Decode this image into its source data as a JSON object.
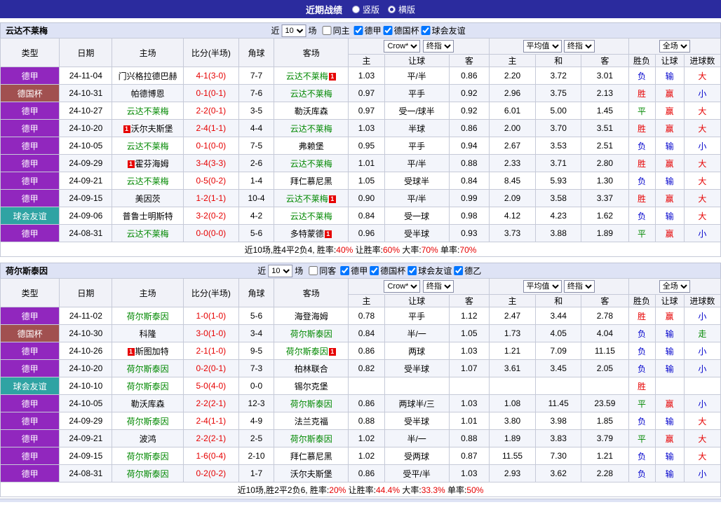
{
  "topbar": {
    "title": "近期战绩",
    "options": [
      {
        "label": "竖版",
        "selected": false
      },
      {
        "label": "横版",
        "selected": true
      }
    ]
  },
  "columns": {
    "type": "类型",
    "date": "日期",
    "home": "主场",
    "score": "比分(半场)",
    "corners": "角球",
    "away": "客场",
    "sub": [
      "主",
      "让球",
      "客",
      "主",
      "和",
      "客",
      "胜负",
      "让球",
      "进球数"
    ],
    "selects": {
      "book": "Crow*",
      "final1": "终指",
      "avg": "平均值",
      "final2": "终指",
      "full": "全场"
    }
  },
  "colors": {
    "topbar_bg": "#2B2B9E",
    "section_bar_bg": "#DEE3F5",
    "header_bg": "#F1F2F8",
    "stripe": "#F3F5FB",
    "score": "#E60000",
    "focus_team": "#008800",
    "win": "#E60000",
    "draw": "#008800",
    "loss": "#0000CC",
    "leagues": {
      "德甲": "#9127BE",
      "德国杯": "#A15050",
      "球会友谊": "#2FA3A3"
    }
  },
  "sections": [
    {
      "team": "云达不莱梅",
      "filter": {
        "near": "近",
        "count": "10",
        "unit": "场",
        "same": "同主",
        "same_checked": false,
        "leagues": [
          {
            "label": "德甲",
            "checked": true
          },
          {
            "label": "德国杯",
            "checked": true
          },
          {
            "label": "球会友谊",
            "checked": true
          }
        ]
      },
      "rows": [
        {
          "league": "德甲",
          "date": "24-11-04",
          "home": {
            "name": "门兴格拉德巴赫",
            "focus": false
          },
          "score": "4-1(3-0)",
          "corners": "7-7",
          "away": {
            "name": "云达不莱梅",
            "focus": true,
            "badge_pos": "post",
            "badge_num": "1"
          },
          "odds": [
            "1.03",
            "平/半",
            "0.86",
            "2.20",
            "3.72",
            "3.01"
          ],
          "results": [
            "负",
            "输",
            "大"
          ]
        },
        {
          "league": "德国杯",
          "date": "24-10-31",
          "home": {
            "name": "帕德博恩",
            "focus": false
          },
          "score": "0-1(0-1)",
          "corners": "7-6",
          "away": {
            "name": "云达不莱梅",
            "focus": true
          },
          "odds": [
            "0.97",
            "平手",
            "0.92",
            "2.96",
            "3.75",
            "2.13"
          ],
          "results": [
            "胜",
            "赢",
            "小"
          ]
        },
        {
          "league": "德甲",
          "date": "24-10-27",
          "home": {
            "name": "云达不莱梅",
            "focus": true
          },
          "score": "2-2(0-1)",
          "corners": "3-5",
          "away": {
            "name": "勒沃库森",
            "focus": false
          },
          "odds": [
            "0.97",
            "受一/球半",
            "0.92",
            "6.01",
            "5.00",
            "1.45"
          ],
          "results": [
            "平",
            "赢",
            "大"
          ]
        },
        {
          "league": "德甲",
          "date": "24-10-20",
          "home": {
            "name": "沃尔夫斯堡",
            "focus": false,
            "badge_pos": "pre",
            "badge_num": "1"
          },
          "score": "2-4(1-1)",
          "corners": "4-4",
          "away": {
            "name": "云达不莱梅",
            "focus": true
          },
          "odds": [
            "1.03",
            "半球",
            "0.86",
            "2.00",
            "3.70",
            "3.51"
          ],
          "results": [
            "胜",
            "赢",
            "大"
          ]
        },
        {
          "league": "德甲",
          "date": "24-10-05",
          "home": {
            "name": "云达不莱梅",
            "focus": true
          },
          "score": "0-1(0-0)",
          "corners": "7-5",
          "away": {
            "name": "弗赖堡",
            "focus": false
          },
          "odds": [
            "0.95",
            "平手",
            "0.94",
            "2.67",
            "3.53",
            "2.51"
          ],
          "results": [
            "负",
            "输",
            "小"
          ]
        },
        {
          "league": "德甲",
          "date": "24-09-29",
          "home": {
            "name": "霍芬海姆",
            "focus": false,
            "badge_pos": "pre",
            "badge_num": "1"
          },
          "score": "3-4(3-3)",
          "corners": "2-6",
          "away": {
            "name": "云达不莱梅",
            "focus": true
          },
          "odds": [
            "1.01",
            "平/半",
            "0.88",
            "2.33",
            "3.71",
            "2.80"
          ],
          "results": [
            "胜",
            "赢",
            "大"
          ]
        },
        {
          "league": "德甲",
          "date": "24-09-21",
          "home": {
            "name": "云达不莱梅",
            "focus": true
          },
          "score": "0-5(0-2)",
          "corners": "1-4",
          "away": {
            "name": "拜仁慕尼黑",
            "focus": false
          },
          "odds": [
            "1.05",
            "受球半",
            "0.84",
            "8.45",
            "5.93",
            "1.30"
          ],
          "results": [
            "负",
            "输",
            "大"
          ]
        },
        {
          "league": "德甲",
          "date": "24-09-15",
          "home": {
            "name": "美因茨",
            "focus": false
          },
          "score": "1-2(1-1)",
          "corners": "10-4",
          "away": {
            "name": "云达不莱梅",
            "focus": true,
            "badge_pos": "post",
            "badge_num": "1"
          },
          "odds": [
            "0.90",
            "平/半",
            "0.99",
            "2.09",
            "3.58",
            "3.37"
          ],
          "results": [
            "胜",
            "赢",
            "大"
          ]
        },
        {
          "league": "球会友谊",
          "date": "24-09-06",
          "home": {
            "name": "普鲁士明斯特",
            "focus": false
          },
          "score": "3-2(0-2)",
          "corners": "4-2",
          "away": {
            "name": "云达不莱梅",
            "focus": true
          },
          "odds": [
            "0.84",
            "受一球",
            "0.98",
            "4.12",
            "4.23",
            "1.62"
          ],
          "results": [
            "负",
            "输",
            "大"
          ]
        },
        {
          "league": "德甲",
          "date": "24-08-31",
          "home": {
            "name": "云达不莱梅",
            "focus": true
          },
          "score": "0-0(0-0)",
          "corners": "5-6",
          "away": {
            "name": "多特蒙德",
            "focus": false,
            "badge_pos": "post",
            "badge_num": "1"
          },
          "odds": [
            "0.96",
            "受半球",
            "0.93",
            "3.73",
            "3.88",
            "1.89"
          ],
          "results": [
            "平",
            "赢",
            "小"
          ]
        }
      ],
      "summary": [
        {
          "text": "近10场,胜4平2负4, 胜率:",
          "red": false
        },
        {
          "text": "40%",
          "red": true
        },
        {
          "text": " 让胜率:",
          "red": false
        },
        {
          "text": "60%",
          "red": true
        },
        {
          "text": " 大率:",
          "red": false
        },
        {
          "text": "70%",
          "red": true
        },
        {
          "text": " 单率:",
          "red": false
        },
        {
          "text": "70%",
          "red": true
        }
      ]
    },
    {
      "team": "荷尔斯泰因",
      "filter": {
        "near": "近",
        "count": "10",
        "unit": "场",
        "same": "同客",
        "same_checked": false,
        "leagues": [
          {
            "label": "德甲",
            "checked": true
          },
          {
            "label": "德国杯",
            "checked": true
          },
          {
            "label": "球会友谊",
            "checked": true
          },
          {
            "label": "德乙",
            "checked": true
          }
        ]
      },
      "rows": [
        {
          "league": "德甲",
          "date": "24-11-02",
          "home": {
            "name": "荷尔斯泰因",
            "focus": true
          },
          "score": "1-0(1-0)",
          "corners": "5-6",
          "away": {
            "name": "海登海姆",
            "focus": false
          },
          "odds": [
            "0.78",
            "平手",
            "1.12",
            "2.47",
            "3.44",
            "2.78"
          ],
          "results": [
            "胜",
            "赢",
            "小"
          ]
        },
        {
          "league": "德国杯",
          "date": "24-10-30",
          "home": {
            "name": "科隆",
            "focus": false
          },
          "score": "3-0(1-0)",
          "corners": "3-4",
          "away": {
            "name": "荷尔斯泰因",
            "focus": true
          },
          "odds": [
            "0.84",
            "半/一",
            "1.05",
            "1.73",
            "4.05",
            "4.04"
          ],
          "results": [
            "负",
            "输",
            "走"
          ]
        },
        {
          "league": "德甲",
          "date": "24-10-26",
          "home": {
            "name": "斯图加特",
            "focus": false,
            "badge_pos": "pre",
            "badge_num": "1"
          },
          "score": "2-1(1-0)",
          "corners": "9-5",
          "away": {
            "name": "荷尔斯泰因",
            "focus": true,
            "badge_pos": "post",
            "badge_num": "1"
          },
          "odds": [
            "0.86",
            "两球",
            "1.03",
            "1.21",
            "7.09",
            "11.15"
          ],
          "results": [
            "负",
            "输",
            "小"
          ]
        },
        {
          "league": "德甲",
          "date": "24-10-20",
          "home": {
            "name": "荷尔斯泰因",
            "focus": true
          },
          "score": "0-2(0-1)",
          "corners": "7-3",
          "away": {
            "name": "柏林联合",
            "focus": false
          },
          "odds": [
            "0.82",
            "受半球",
            "1.07",
            "3.61",
            "3.45",
            "2.05"
          ],
          "results": [
            "负",
            "输",
            "小"
          ]
        },
        {
          "league": "球会友谊",
          "date": "24-10-10",
          "home": {
            "name": "荷尔斯泰因",
            "focus": true
          },
          "score": "5-0(4-0)",
          "corners": "0-0",
          "away": {
            "name": "锡尔克堡",
            "focus": false
          },
          "odds": [
            "",
            "",
            "",
            "",
            "",
            ""
          ],
          "results": [
            "胜",
            "",
            ""
          ]
        },
        {
          "league": "德甲",
          "date": "24-10-05",
          "home": {
            "name": "勒沃库森",
            "focus": false
          },
          "score": "2-2(2-1)",
          "corners": "12-3",
          "away": {
            "name": "荷尔斯泰因",
            "focus": true
          },
          "odds": [
            "0.86",
            "两球半/三",
            "1.03",
            "1.08",
            "11.45",
            "23.59"
          ],
          "results": [
            "平",
            "赢",
            "小"
          ]
        },
        {
          "league": "德甲",
          "date": "24-09-29",
          "home": {
            "name": "荷尔斯泰因",
            "focus": true
          },
          "score": "2-4(1-1)",
          "corners": "4-9",
          "away": {
            "name": "法兰克福",
            "focus": false
          },
          "odds": [
            "0.88",
            "受半球",
            "1.01",
            "3.80",
            "3.98",
            "1.85"
          ],
          "results": [
            "负",
            "输",
            "大"
          ]
        },
        {
          "league": "德甲",
          "date": "24-09-21",
          "home": {
            "name": "波鸿",
            "focus": false
          },
          "score": "2-2(2-1)",
          "corners": "2-5",
          "away": {
            "name": "荷尔斯泰因",
            "focus": true
          },
          "odds": [
            "1.02",
            "半/一",
            "0.88",
            "1.89",
            "3.83",
            "3.79"
          ],
          "results": [
            "平",
            "赢",
            "大"
          ]
        },
        {
          "league": "德甲",
          "date": "24-09-15",
          "home": {
            "name": "荷尔斯泰因",
            "focus": true
          },
          "score": "1-6(0-4)",
          "corners": "2-10",
          "away": {
            "name": "拜仁慕尼黑",
            "focus": false
          },
          "odds": [
            "1.02",
            "受两球",
            "0.87",
            "11.55",
            "7.30",
            "1.21"
          ],
          "results": [
            "负",
            "输",
            "大"
          ]
        },
        {
          "league": "德甲",
          "date": "24-08-31",
          "home": {
            "name": "荷尔斯泰因",
            "focus": true
          },
          "score": "0-2(0-2)",
          "corners": "1-7",
          "away": {
            "name": "沃尔夫斯堡",
            "focus": false
          },
          "odds": [
            "0.86",
            "受平/半",
            "1.03",
            "2.93",
            "3.62",
            "2.28"
          ],
          "results": [
            "负",
            "输",
            "小"
          ]
        }
      ],
      "summary": [
        {
          "text": "近10场,胜2平2负6, 胜率:",
          "red": false
        },
        {
          "text": "20%",
          "red": true
        },
        {
          "text": " 让胜率:",
          "red": false
        },
        {
          "text": "44.4%",
          "red": true
        },
        {
          "text": " 大率:",
          "red": false
        },
        {
          "text": "33.3%",
          "red": true
        },
        {
          "text": " 单率:",
          "red": false
        },
        {
          "text": "50%",
          "red": true
        }
      ]
    }
  ]
}
